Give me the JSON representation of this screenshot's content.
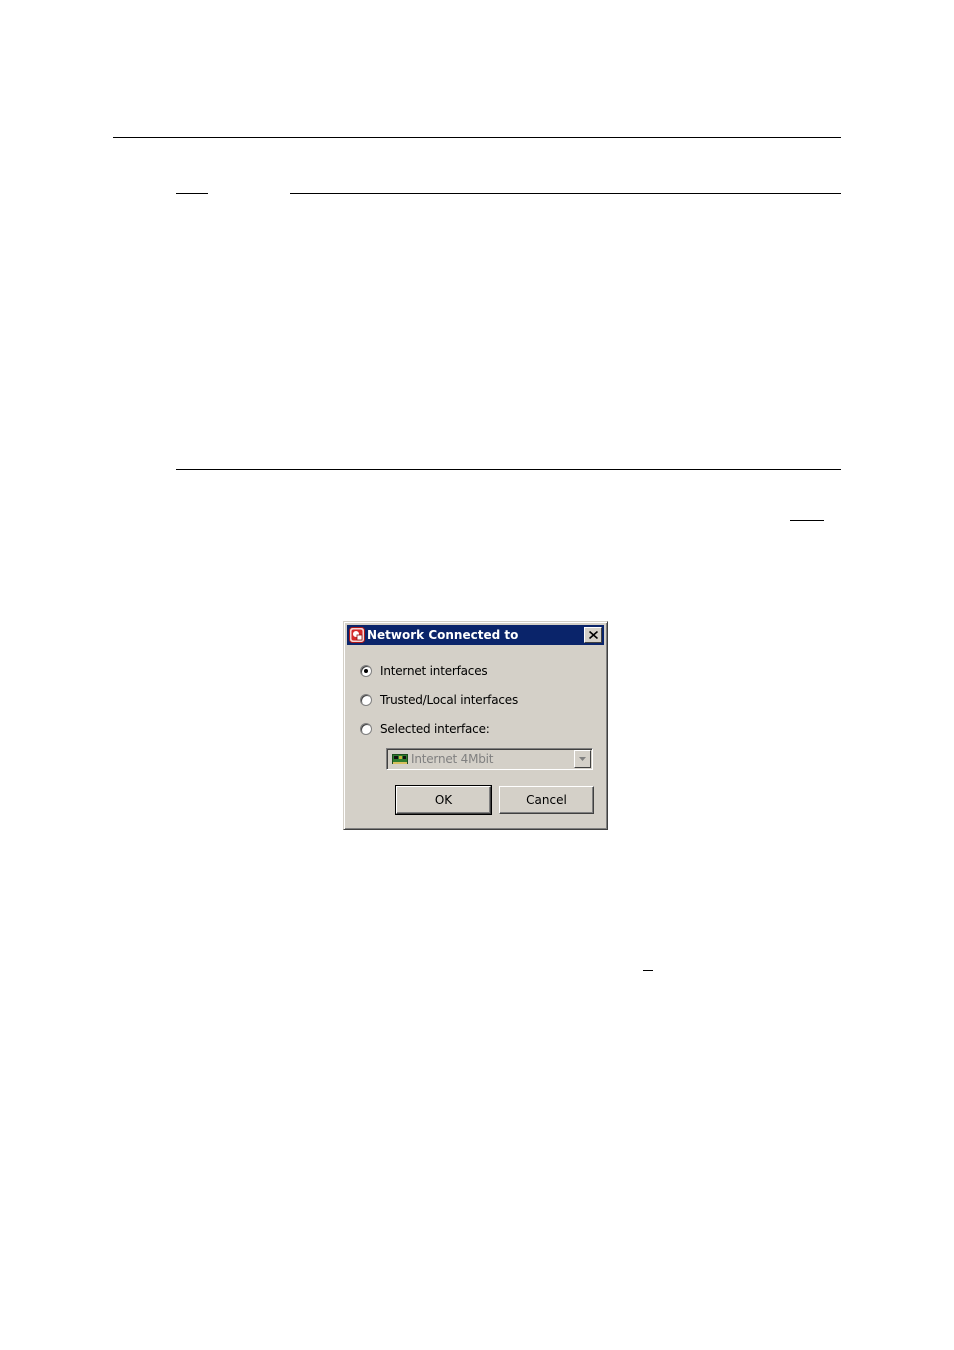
{
  "dialog": {
    "title": "Network Connected to",
    "options": [
      {
        "label": "Internet interfaces",
        "checked": true
      },
      {
        "label": "Trusted/Local  interfaces",
        "checked": false
      },
      {
        "label": "Selected interface:",
        "checked": false
      }
    ],
    "interface_select": {
      "value": "Internet 4Mbit",
      "disabled": true
    },
    "ok_label": "OK",
    "cancel_label": "Cancel"
  },
  "colors": {
    "titlebar": "#0a246a",
    "dialog_face": "#d4d0c8",
    "disabled_text": "#808080"
  },
  "icons": {
    "app": "app-shield-icon",
    "close": "close-icon",
    "network": "network-card-icon",
    "dropdown": "chevron-down-icon"
  }
}
